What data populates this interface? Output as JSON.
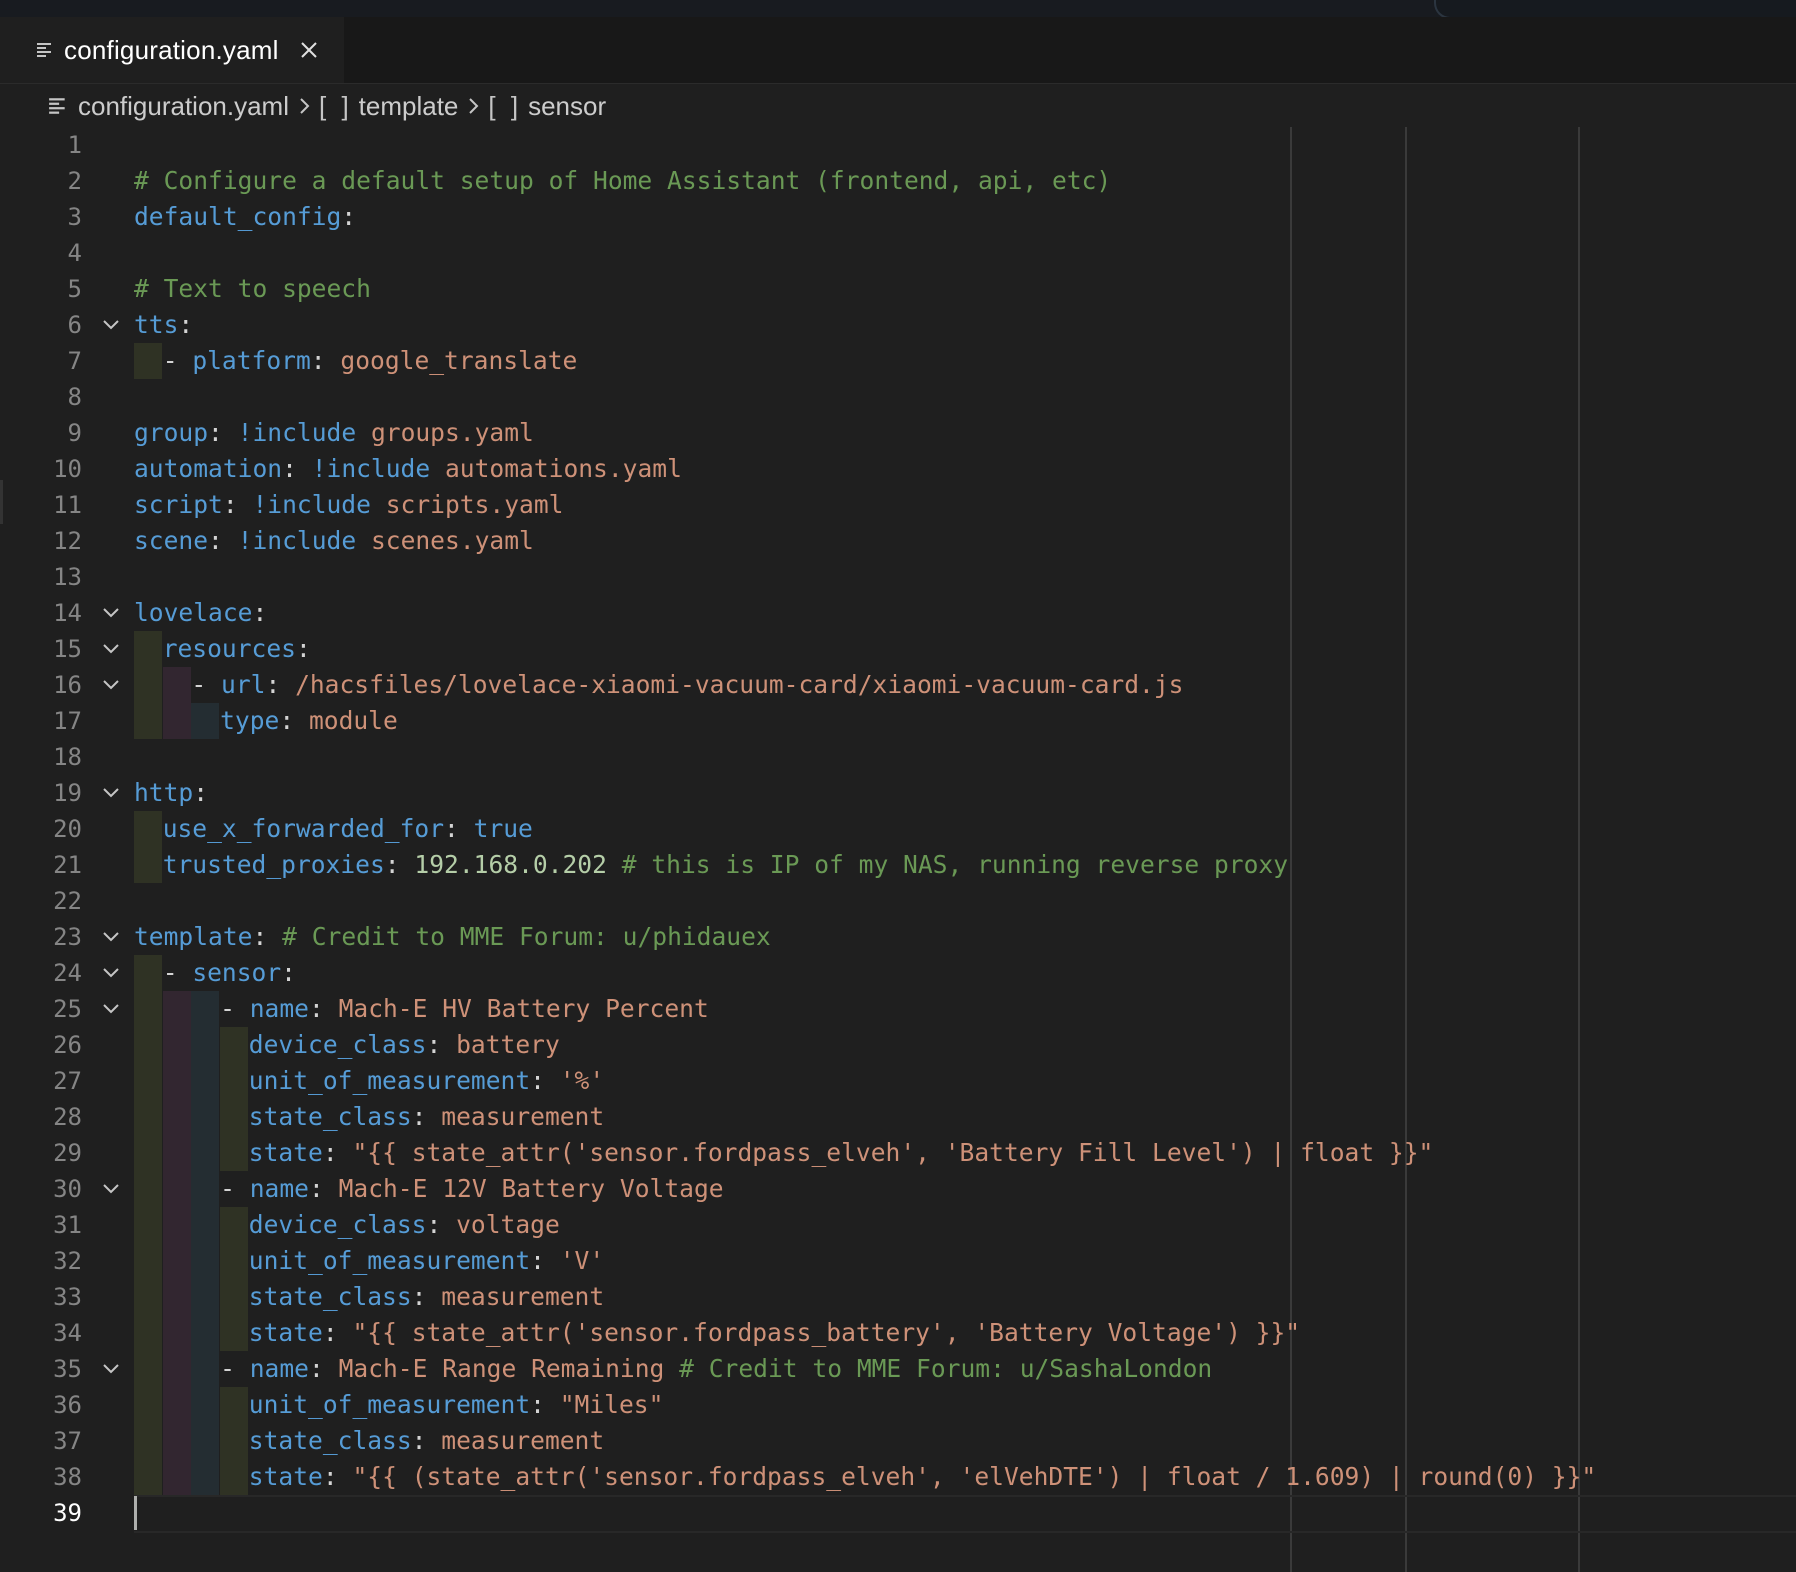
{
  "tab": {
    "label": "configuration.yaml",
    "file_icon": "file-lines-icon",
    "close_icon": "close-icon"
  },
  "breadcrumb": {
    "file": "configuration.yaml",
    "items": [
      {
        "bracket": "[ ]",
        "label": "template"
      },
      {
        "bracket": "[ ]",
        "label": "sensor"
      }
    ],
    "separator_icon": "chevron-right-icon"
  },
  "colors": {
    "key": "#569cd6",
    "string": "#ce9178",
    "comment": "#6a9955",
    "number": "#b5cea8",
    "background": "#1f1f1f"
  },
  "active_line": 39,
  "lines": [
    {
      "n": 1,
      "fold": false,
      "tokens": []
    },
    {
      "n": 2,
      "fold": false,
      "tokens": [
        [
          "c",
          "# Configure a default setup of Home Assistant (frontend, api, etc)"
        ]
      ]
    },
    {
      "n": 3,
      "fold": false,
      "tokens": [
        [
          "k",
          "default_config"
        ],
        [
          "p",
          ":"
        ]
      ]
    },
    {
      "n": 4,
      "fold": false,
      "tokens": []
    },
    {
      "n": 5,
      "fold": false,
      "tokens": [
        [
          "c",
          "# Text to speech"
        ]
      ]
    },
    {
      "n": 6,
      "fold": true,
      "tokens": [
        [
          "k",
          "tts"
        ],
        [
          "p",
          ":"
        ]
      ]
    },
    {
      "n": 7,
      "fold": false,
      "indent": 1,
      "tokens": [
        [
          "p",
          "- "
        ],
        [
          "k",
          "platform"
        ],
        [
          "p",
          ": "
        ],
        [
          "s",
          "google_translate"
        ]
      ]
    },
    {
      "n": 8,
      "fold": false,
      "tokens": []
    },
    {
      "n": 9,
      "fold": false,
      "tokens": [
        [
          "k",
          "group"
        ],
        [
          "p",
          ": "
        ],
        [
          "b",
          "!include"
        ],
        [
          "p",
          " "
        ],
        [
          "s",
          "groups.yaml"
        ]
      ]
    },
    {
      "n": 10,
      "fold": false,
      "tokens": [
        [
          "k",
          "automation"
        ],
        [
          "p",
          ": "
        ],
        [
          "b",
          "!include"
        ],
        [
          "p",
          " "
        ],
        [
          "s",
          "automations.yaml"
        ]
      ]
    },
    {
      "n": 11,
      "fold": false,
      "tokens": [
        [
          "k",
          "script"
        ],
        [
          "p",
          ": "
        ],
        [
          "b",
          "!include"
        ],
        [
          "p",
          " "
        ],
        [
          "s",
          "scripts.yaml"
        ]
      ]
    },
    {
      "n": 12,
      "fold": false,
      "tokens": [
        [
          "k",
          "scene"
        ],
        [
          "p",
          ": "
        ],
        [
          "b",
          "!include"
        ],
        [
          "p",
          " "
        ],
        [
          "s",
          "scenes.yaml"
        ]
      ]
    },
    {
      "n": 13,
      "fold": false,
      "tokens": []
    },
    {
      "n": 14,
      "fold": true,
      "tokens": [
        [
          "k",
          "lovelace"
        ],
        [
          "p",
          ":"
        ]
      ]
    },
    {
      "n": 15,
      "fold": true,
      "indent": 1,
      "tokens": [
        [
          "k",
          "resources"
        ],
        [
          "p",
          ":"
        ]
      ]
    },
    {
      "n": 16,
      "fold": true,
      "indent": 2,
      "tokens": [
        [
          "p",
          "- "
        ],
        [
          "k",
          "url"
        ],
        [
          "p",
          ": "
        ],
        [
          "s",
          "/hacsfiles/lovelace-xiaomi-vacuum-card/xiaomi-vacuum-card.js"
        ]
      ]
    },
    {
      "n": 17,
      "fold": false,
      "indent": 3,
      "tokens": [
        [
          "k",
          "type"
        ],
        [
          "p",
          ": "
        ],
        [
          "s",
          "module"
        ]
      ]
    },
    {
      "n": 18,
      "fold": false,
      "tokens": []
    },
    {
      "n": 19,
      "fold": true,
      "tokens": [
        [
          "k",
          "http"
        ],
        [
          "p",
          ":"
        ]
      ]
    },
    {
      "n": 20,
      "fold": false,
      "indent": 1,
      "tokens": [
        [
          "k",
          "use_x_forwarded_for"
        ],
        [
          "p",
          ": "
        ],
        [
          "b",
          "true"
        ]
      ]
    },
    {
      "n": 21,
      "fold": false,
      "indent": 1,
      "tokens": [
        [
          "k",
          "trusted_proxies"
        ],
        [
          "p",
          ": "
        ],
        [
          "n",
          "192.168.0.202"
        ],
        [
          "p",
          " "
        ],
        [
          "c",
          "# this is IP of my NAS, running reverse proxy"
        ]
      ]
    },
    {
      "n": 22,
      "fold": false,
      "tokens": []
    },
    {
      "n": 23,
      "fold": true,
      "tokens": [
        [
          "k",
          "template"
        ],
        [
          "p",
          ": "
        ],
        [
          "c",
          "# Credit to MME Forum: u/phidauex"
        ]
      ]
    },
    {
      "n": 24,
      "fold": true,
      "indent": 1,
      "tokens": [
        [
          "p",
          "- "
        ],
        [
          "k",
          "sensor"
        ],
        [
          "p",
          ":"
        ]
      ]
    },
    {
      "n": 25,
      "fold": true,
      "indent": 3,
      "tokens": [
        [
          "p",
          "- "
        ],
        [
          "k",
          "name"
        ],
        [
          "p",
          ": "
        ],
        [
          "s",
          "Mach-E HV Battery Percent"
        ]
      ]
    },
    {
      "n": 26,
      "fold": false,
      "indent": 4,
      "tokens": [
        [
          "k",
          "device_class"
        ],
        [
          "p",
          ": "
        ],
        [
          "s",
          "battery"
        ]
      ]
    },
    {
      "n": 27,
      "fold": false,
      "indent": 4,
      "tokens": [
        [
          "k",
          "unit_of_measurement"
        ],
        [
          "p",
          ": "
        ],
        [
          "s",
          "'%'"
        ]
      ]
    },
    {
      "n": 28,
      "fold": false,
      "indent": 4,
      "tokens": [
        [
          "k",
          "state_class"
        ],
        [
          "p",
          ": "
        ],
        [
          "s",
          "measurement"
        ]
      ]
    },
    {
      "n": 29,
      "fold": false,
      "indent": 4,
      "tokens": [
        [
          "k",
          "state"
        ],
        [
          "p",
          ": "
        ],
        [
          "s",
          "\"{{ state_attr('sensor.fordpass_elveh', 'Battery Fill Level') | float }}\""
        ]
      ]
    },
    {
      "n": 30,
      "fold": true,
      "indent": 3,
      "tokens": [
        [
          "p",
          "- "
        ],
        [
          "k",
          "name"
        ],
        [
          "p",
          ": "
        ],
        [
          "s",
          "Mach-E 12V Battery Voltage"
        ]
      ]
    },
    {
      "n": 31,
      "fold": false,
      "indent": 4,
      "tokens": [
        [
          "k",
          "device_class"
        ],
        [
          "p",
          ": "
        ],
        [
          "s",
          "voltage"
        ]
      ]
    },
    {
      "n": 32,
      "fold": false,
      "indent": 4,
      "tokens": [
        [
          "k",
          "unit_of_measurement"
        ],
        [
          "p",
          ": "
        ],
        [
          "s",
          "'V'"
        ]
      ]
    },
    {
      "n": 33,
      "fold": false,
      "indent": 4,
      "tokens": [
        [
          "k",
          "state_class"
        ],
        [
          "p",
          ": "
        ],
        [
          "s",
          "measurement"
        ]
      ]
    },
    {
      "n": 34,
      "fold": false,
      "indent": 4,
      "tokens": [
        [
          "k",
          "state"
        ],
        [
          "p",
          ": "
        ],
        [
          "s",
          "\"{{ state_attr('sensor.fordpass_battery', 'Battery Voltage') }}\""
        ]
      ]
    },
    {
      "n": 35,
      "fold": true,
      "indent": 3,
      "tokens": [
        [
          "p",
          "- "
        ],
        [
          "k",
          "name"
        ],
        [
          "p",
          ": "
        ],
        [
          "s",
          "Mach-E Range Remaining"
        ],
        [
          "p",
          " "
        ],
        [
          "c",
          "# Credit to MME Forum: u/SashaLondon"
        ]
      ]
    },
    {
      "n": 36,
      "fold": false,
      "indent": 4,
      "tokens": [
        [
          "k",
          "unit_of_measurement"
        ],
        [
          "p",
          ": "
        ],
        [
          "s",
          "\"Miles\""
        ]
      ]
    },
    {
      "n": 37,
      "fold": false,
      "indent": 4,
      "tokens": [
        [
          "k",
          "state_class"
        ],
        [
          "p",
          ": "
        ],
        [
          "s",
          "measurement"
        ]
      ]
    },
    {
      "n": 38,
      "fold": false,
      "indent": 4,
      "tokens": [
        [
          "k",
          "state"
        ],
        [
          "p",
          ": "
        ],
        [
          "s",
          "\"{{ (state_attr('sensor.fordpass_elveh', 'elVehDTE') | float / 1.609) | round(0) }}\""
        ]
      ]
    },
    {
      "n": 39,
      "fold": false,
      "tokens": []
    }
  ]
}
